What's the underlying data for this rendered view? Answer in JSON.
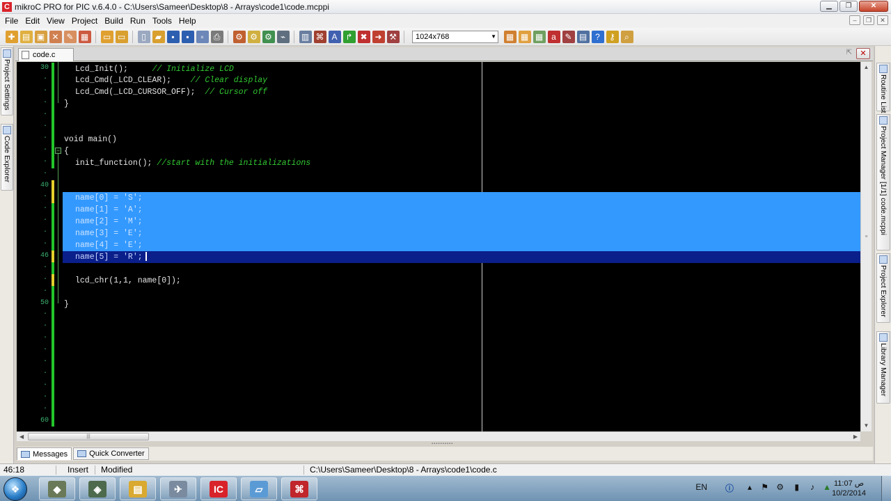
{
  "window": {
    "app_icon_text": "C",
    "title": "mikroC PRO for PIC v.6.4.0 - C:\\Users\\Sameer\\Desktop\\8 - Arrays\\code1\\code.mcppi",
    "minimize": "▁",
    "maximize": "❐",
    "close": "✕"
  },
  "menu": {
    "items": [
      "File",
      "Edit",
      "View",
      "Project",
      "Build",
      "Run",
      "Tools",
      "Help"
    ]
  },
  "toolbar": {
    "resolution": "1024x768",
    "icons": [
      {
        "name": "new-project-icon",
        "color": "#e0a030",
        "glyph": "✚"
      },
      {
        "name": "open-project-icon",
        "color": "#e0b040",
        "glyph": "▤"
      },
      {
        "name": "save-project-icon",
        "color": "#d8a040",
        "glyph": "▣"
      },
      {
        "name": "close-project-icon",
        "color": "#d08050",
        "glyph": "✕"
      },
      {
        "name": "edit-project-icon",
        "color": "#d89060",
        "glyph": "✎"
      },
      {
        "name": "clean-project-icon",
        "color": "#cc5a40",
        "glyph": "▦"
      },
      {
        "name": "open-file-icon",
        "color": "#e0a030",
        "glyph": "▭"
      },
      {
        "name": "open-folder-icon",
        "color": "#d9a030",
        "glyph": "▭"
      },
      {
        "name": "new-file-icon",
        "color": "#9aa8c0",
        "glyph": "▯"
      },
      {
        "name": "open-file-2-icon",
        "color": "#d9a030",
        "glyph": "▰"
      },
      {
        "name": "save-icon",
        "color": "#2d5fb0",
        "glyph": "▪"
      },
      {
        "name": "save-all-icon",
        "color": "#2d5fb0",
        "glyph": "▪"
      },
      {
        "name": "save-as-icon",
        "color": "#6c87b8",
        "glyph": "▫"
      },
      {
        "name": "print-icon",
        "color": "#7a7a7a",
        "glyph": "⎙"
      },
      {
        "name": "build-icon",
        "color": "#c06030",
        "glyph": "⚙"
      },
      {
        "name": "build-all-icon",
        "color": "#d0b040",
        "glyph": "⚙"
      },
      {
        "name": "build-program-icon",
        "color": "#409050",
        "glyph": "⚙"
      },
      {
        "name": "programmer-icon",
        "color": "#5f6f7f",
        "glyph": "⌁"
      },
      {
        "name": "compile-icon",
        "color": "#6a7fa0",
        "glyph": "▥"
      },
      {
        "name": "debug-icon",
        "color": "#a04030",
        "glyph": "⌘"
      },
      {
        "name": "font-icon",
        "color": "#4060b0",
        "glyph": "A"
      },
      {
        "name": "jump-icon",
        "color": "#30a030",
        "glyph": "↱"
      },
      {
        "name": "stop-icon",
        "color": "#c03030",
        "glyph": "✖"
      },
      {
        "name": "step-icon",
        "color": "#c04030",
        "glyph": "➜"
      },
      {
        "name": "tools-icon",
        "color": "#a04040",
        "glyph": "⚒"
      },
      {
        "name": "view-1-icon",
        "color": "#d08030",
        "glyph": "▦"
      },
      {
        "name": "view-2-icon",
        "color": "#e0a040",
        "glyph": "▦"
      },
      {
        "name": "view-3-icon",
        "color": "#70a060",
        "glyph": "▦"
      },
      {
        "name": "pdf-icon",
        "color": "#c03030",
        "glyph": "a"
      },
      {
        "name": "doc-icon",
        "color": "#a04040",
        "glyph": "✎"
      },
      {
        "name": "grid-icon",
        "color": "#5070a0",
        "glyph": "▤"
      },
      {
        "name": "help-icon",
        "color": "#2f6fd0",
        "glyph": "?"
      },
      {
        "name": "key-icon",
        "color": "#d0a020",
        "glyph": "⚷"
      },
      {
        "name": "search-icon",
        "color": "#d0a040",
        "glyph": "⌕"
      }
    ]
  },
  "left_panels": [
    "Project Settings",
    "Code Explorer"
  ],
  "right_panels": [
    "Routine List",
    "Project Manager [1/1] code.mcppi",
    "Project Explorer",
    "Library Manager"
  ],
  "editor": {
    "tab_label": "code.c",
    "line_numbers": [
      {
        "label": "30",
        "row": 0
      },
      {
        "label": "40",
        "row": 10
      },
      {
        "label": "46",
        "row": 16
      },
      {
        "label": "50",
        "row": 20
      },
      {
        "label": "60",
        "row": 30
      }
    ],
    "lines": [
      {
        "row": 0,
        "indent": 2,
        "code": "Lcd_Init();",
        "comment": "// Initialize LCD",
        "gap": "     "
      },
      {
        "row": 1,
        "indent": 2,
        "code": "Lcd_Cmd(_LCD_CLEAR);",
        "comment": "// Clear display",
        "gap": "    "
      },
      {
        "row": 2,
        "indent": 2,
        "code": "Lcd_Cmd(_LCD_CURSOR_OFF);",
        "comment": "// Cursor off",
        "gap": "  "
      },
      {
        "row": 3,
        "indent": 0,
        "code": "}",
        "comment": "",
        "gap": ""
      },
      {
        "row": 6,
        "indent": 0,
        "code": "void main()",
        "comment": "",
        "gap": ""
      },
      {
        "row": 7,
        "indent": 0,
        "code": "{",
        "comment": "",
        "gap": ""
      },
      {
        "row": 8,
        "indent": 2,
        "code": "init_function();",
        "comment": "//start with the initializations",
        "gap": " "
      },
      {
        "row": 11,
        "indent": 2,
        "code": "name[0] = 'S';",
        "comment": "",
        "gap": "",
        "selected": true
      },
      {
        "row": 12,
        "indent": 2,
        "code": "name[1] = 'A';",
        "comment": "",
        "gap": "",
        "selected": true
      },
      {
        "row": 13,
        "indent": 2,
        "code": "name[2] = 'M';",
        "comment": "",
        "gap": "",
        "selected": true
      },
      {
        "row": 14,
        "indent": 2,
        "code": "name[3] = 'E';",
        "comment": "",
        "gap": "",
        "selected": true
      },
      {
        "row": 15,
        "indent": 2,
        "code": "name[4] = 'E';",
        "comment": "",
        "gap": "",
        "selected": true
      },
      {
        "row": 16,
        "indent": 2,
        "code": "name[5] = 'R';",
        "comment": "",
        "gap": "",
        "selected": true,
        "current": true
      },
      {
        "row": 18,
        "indent": 2,
        "code": "lcd_chr(1,1, name[0]);",
        "comment": "",
        "gap": ""
      },
      {
        "row": 20,
        "indent": 0,
        "code": "}",
        "comment": "",
        "gap": ""
      }
    ]
  },
  "bottom_tabs": [
    "Messages",
    "Quick Converter"
  ],
  "status": {
    "position": "46:18",
    "mode": "Insert",
    "state": "Modified",
    "path": "C:\\Users\\Sameer\\Desktop\\8 - Arrays\\code1\\code.c"
  },
  "taskbar": {
    "start_glyph": "❖",
    "apps": [
      {
        "name": "taskbar-app-1",
        "glyph": "◆",
        "color": "#6a7a58"
      },
      {
        "name": "taskbar-app-2",
        "glyph": "◈",
        "color": "#4d6a4d"
      },
      {
        "name": "taskbar-explorer",
        "glyph": "▤",
        "color": "#d9a930"
      },
      {
        "name": "taskbar-app-4",
        "glyph": "✈",
        "color": "#7a8ba0"
      },
      {
        "name": "taskbar-mikroc",
        "glyph": "IC",
        "color": "#d9232a"
      },
      {
        "name": "taskbar-app-6",
        "glyph": "▱",
        "color": "#5b9bd5"
      },
      {
        "name": "taskbar-acrobat",
        "glyph": "⌘",
        "color": "#c0262b"
      }
    ],
    "language": "EN",
    "clock_time": "11:07 ص",
    "clock_date": "10/2/2014"
  }
}
